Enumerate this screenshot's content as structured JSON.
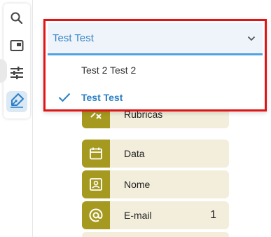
{
  "rail": {
    "tools": [
      {
        "icon": "search-icon"
      },
      {
        "icon": "panel-icon"
      },
      {
        "icon": "sliders-icon"
      },
      {
        "icon": "pen-icon",
        "active": true
      }
    ]
  },
  "fields": [
    {
      "label": "Rubricas",
      "icon": "initials-icon",
      "count": ""
    },
    {
      "label": "Data",
      "icon": "calendar-icon",
      "count": ""
    },
    {
      "label": "Nome",
      "icon": "id-card-icon",
      "count": ""
    },
    {
      "label": "E-mail",
      "icon": "at-icon",
      "count": "1"
    }
  ],
  "signer_select": {
    "value": "Test Test",
    "options": [
      {
        "label": "Test 2 Test 2",
        "selected": false
      },
      {
        "label": "Test Test",
        "selected": true
      }
    ]
  },
  "colors": {
    "accent": "#3b86c8",
    "highlight_border": "#e01414",
    "field_icon_bg": "#a59a1f",
    "field_bg": "#f3eedc"
  }
}
